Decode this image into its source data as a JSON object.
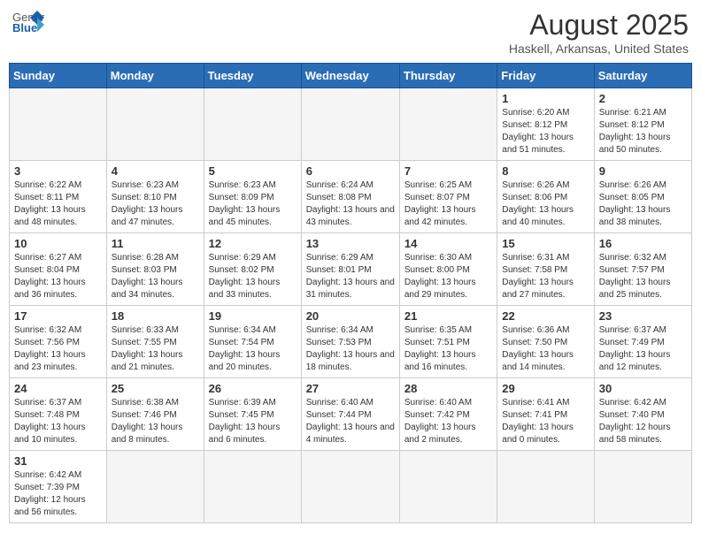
{
  "header": {
    "logo_general": "General",
    "logo_blue": "Blue",
    "title": "August 2025",
    "subtitle": "Haskell, Arkansas, United States"
  },
  "days_of_week": [
    "Sunday",
    "Monday",
    "Tuesday",
    "Wednesday",
    "Thursday",
    "Friday",
    "Saturday"
  ],
  "weeks": [
    [
      {
        "day": "",
        "info": ""
      },
      {
        "day": "",
        "info": ""
      },
      {
        "day": "",
        "info": ""
      },
      {
        "day": "",
        "info": ""
      },
      {
        "day": "",
        "info": ""
      },
      {
        "day": "1",
        "info": "Sunrise: 6:20 AM\nSunset: 8:12 PM\nDaylight: 13 hours and 51 minutes."
      },
      {
        "day": "2",
        "info": "Sunrise: 6:21 AM\nSunset: 8:12 PM\nDaylight: 13 hours and 50 minutes."
      }
    ],
    [
      {
        "day": "3",
        "info": "Sunrise: 6:22 AM\nSunset: 8:11 PM\nDaylight: 13 hours and 48 minutes."
      },
      {
        "day": "4",
        "info": "Sunrise: 6:23 AM\nSunset: 8:10 PM\nDaylight: 13 hours and 47 minutes."
      },
      {
        "day": "5",
        "info": "Sunrise: 6:23 AM\nSunset: 8:09 PM\nDaylight: 13 hours and 45 minutes."
      },
      {
        "day": "6",
        "info": "Sunrise: 6:24 AM\nSunset: 8:08 PM\nDaylight: 13 hours and 43 minutes."
      },
      {
        "day": "7",
        "info": "Sunrise: 6:25 AM\nSunset: 8:07 PM\nDaylight: 13 hours and 42 minutes."
      },
      {
        "day": "8",
        "info": "Sunrise: 6:26 AM\nSunset: 8:06 PM\nDaylight: 13 hours and 40 minutes."
      },
      {
        "day": "9",
        "info": "Sunrise: 6:26 AM\nSunset: 8:05 PM\nDaylight: 13 hours and 38 minutes."
      }
    ],
    [
      {
        "day": "10",
        "info": "Sunrise: 6:27 AM\nSunset: 8:04 PM\nDaylight: 13 hours and 36 minutes."
      },
      {
        "day": "11",
        "info": "Sunrise: 6:28 AM\nSunset: 8:03 PM\nDaylight: 13 hours and 34 minutes."
      },
      {
        "day": "12",
        "info": "Sunrise: 6:29 AM\nSunset: 8:02 PM\nDaylight: 13 hours and 33 minutes."
      },
      {
        "day": "13",
        "info": "Sunrise: 6:29 AM\nSunset: 8:01 PM\nDaylight: 13 hours and 31 minutes."
      },
      {
        "day": "14",
        "info": "Sunrise: 6:30 AM\nSunset: 8:00 PM\nDaylight: 13 hours and 29 minutes."
      },
      {
        "day": "15",
        "info": "Sunrise: 6:31 AM\nSunset: 7:58 PM\nDaylight: 13 hours and 27 minutes."
      },
      {
        "day": "16",
        "info": "Sunrise: 6:32 AM\nSunset: 7:57 PM\nDaylight: 13 hours and 25 minutes."
      }
    ],
    [
      {
        "day": "17",
        "info": "Sunrise: 6:32 AM\nSunset: 7:56 PM\nDaylight: 13 hours and 23 minutes."
      },
      {
        "day": "18",
        "info": "Sunrise: 6:33 AM\nSunset: 7:55 PM\nDaylight: 13 hours and 21 minutes."
      },
      {
        "day": "19",
        "info": "Sunrise: 6:34 AM\nSunset: 7:54 PM\nDaylight: 13 hours and 20 minutes."
      },
      {
        "day": "20",
        "info": "Sunrise: 6:34 AM\nSunset: 7:53 PM\nDaylight: 13 hours and 18 minutes."
      },
      {
        "day": "21",
        "info": "Sunrise: 6:35 AM\nSunset: 7:51 PM\nDaylight: 13 hours and 16 minutes."
      },
      {
        "day": "22",
        "info": "Sunrise: 6:36 AM\nSunset: 7:50 PM\nDaylight: 13 hours and 14 minutes."
      },
      {
        "day": "23",
        "info": "Sunrise: 6:37 AM\nSunset: 7:49 PM\nDaylight: 13 hours and 12 minutes."
      }
    ],
    [
      {
        "day": "24",
        "info": "Sunrise: 6:37 AM\nSunset: 7:48 PM\nDaylight: 13 hours and 10 minutes."
      },
      {
        "day": "25",
        "info": "Sunrise: 6:38 AM\nSunset: 7:46 PM\nDaylight: 13 hours and 8 minutes."
      },
      {
        "day": "26",
        "info": "Sunrise: 6:39 AM\nSunset: 7:45 PM\nDaylight: 13 hours and 6 minutes."
      },
      {
        "day": "27",
        "info": "Sunrise: 6:40 AM\nSunset: 7:44 PM\nDaylight: 13 hours and 4 minutes."
      },
      {
        "day": "28",
        "info": "Sunrise: 6:40 AM\nSunset: 7:42 PM\nDaylight: 13 hours and 2 minutes."
      },
      {
        "day": "29",
        "info": "Sunrise: 6:41 AM\nSunset: 7:41 PM\nDaylight: 13 hours and 0 minutes."
      },
      {
        "day": "30",
        "info": "Sunrise: 6:42 AM\nSunset: 7:40 PM\nDaylight: 12 hours and 58 minutes."
      }
    ],
    [
      {
        "day": "31",
        "info": "Sunrise: 6:42 AM\nSunset: 7:39 PM\nDaylight: 12 hours and 56 minutes."
      },
      {
        "day": "",
        "info": ""
      },
      {
        "day": "",
        "info": ""
      },
      {
        "day": "",
        "info": ""
      },
      {
        "day": "",
        "info": ""
      },
      {
        "day": "",
        "info": ""
      },
      {
        "day": "",
        "info": ""
      }
    ]
  ]
}
